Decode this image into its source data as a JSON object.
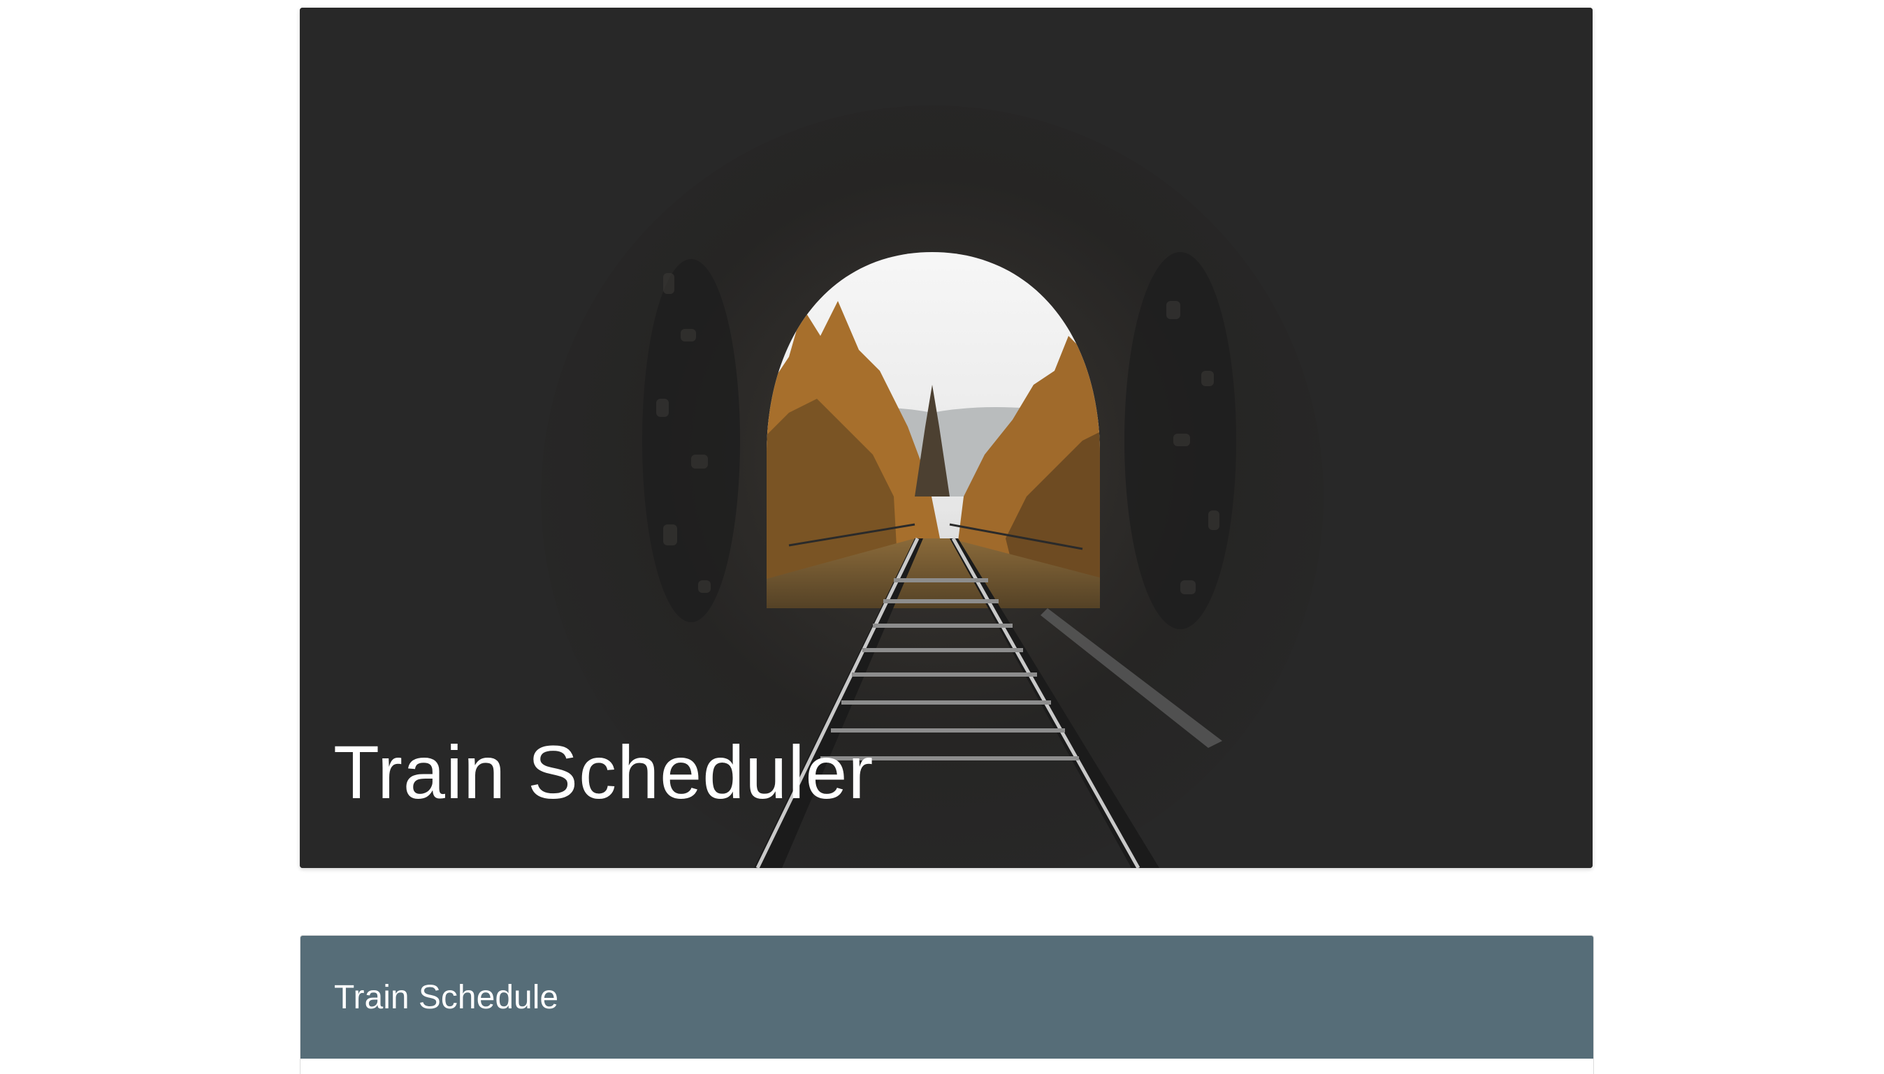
{
  "hero": {
    "title": "Train Scheduler",
    "image_icon": "tunnel-railway-photo"
  },
  "schedule_panel": {
    "title": "Train Schedule"
  },
  "colors": {
    "hero_background": "#282828",
    "panel_heading": "#566d78",
    "title_text": "#ffffff"
  }
}
